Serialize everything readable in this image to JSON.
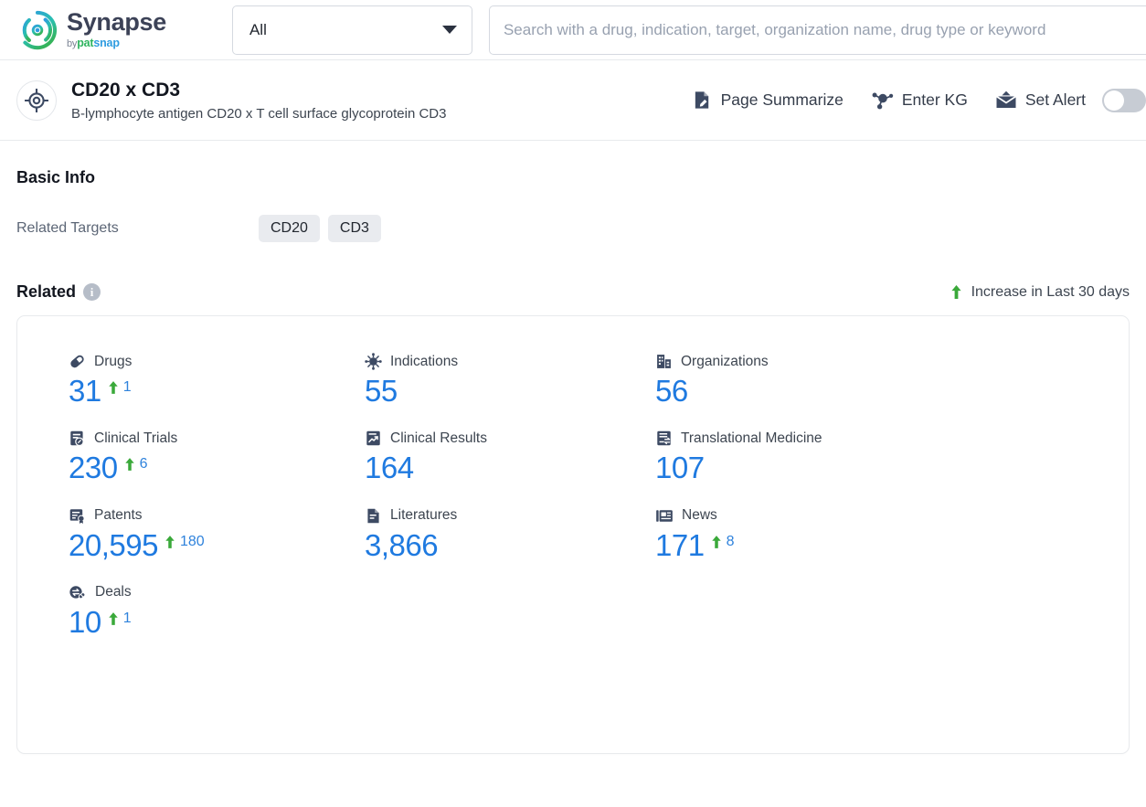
{
  "topbar": {
    "logo_name": "Synapse",
    "logo_by": "by",
    "logo_pat": "pat",
    "logo_snap": "snap",
    "scope_select_value": "All",
    "search_placeholder": "Search with a drug, indication, target, organization name, drug type or keyword",
    "search_value": ""
  },
  "entity": {
    "name": "CD20 x CD3",
    "description": "B-lymphocyte antigen CD20 x T cell surface glycoprotein CD3",
    "actions": [
      {
        "label": "Page Summarize",
        "icon": "page-summarize-icon"
      },
      {
        "label": "Enter KG",
        "icon": "knowledge-graph-icon"
      },
      {
        "label": "Set Alert",
        "icon": "alert-mail-icon"
      }
    ],
    "alert_toggle_on": false
  },
  "basic_info": {
    "title": "Basic Info",
    "related_targets_label": "Related Targets",
    "related_targets": [
      "CD20",
      "CD3"
    ]
  },
  "related": {
    "title": "Related",
    "info_glyph": "i",
    "legend_text": "Increase in Last 30 days",
    "legend_arrow_color": "#3aa93a",
    "value_color": "#1f7ae0",
    "stats": [
      {
        "label": "Drugs",
        "icon": "pill-icon",
        "value": "31",
        "delta": "1"
      },
      {
        "label": "Indications",
        "icon": "virus-icon",
        "value": "55",
        "delta": ""
      },
      {
        "label": "Organizations",
        "icon": "building-icon",
        "value": "56",
        "delta": ""
      },
      {
        "label": "Clinical Trials",
        "icon": "clinical-trial-icon",
        "value": "230",
        "delta": "6"
      },
      {
        "label": "Clinical Results",
        "icon": "clinical-result-icon",
        "value": "164",
        "delta": ""
      },
      {
        "label": "Translational Medicine",
        "icon": "translational-medicine-icon",
        "value": "107",
        "delta": ""
      },
      {
        "label": "Patents",
        "icon": "patent-icon",
        "value": "20,595",
        "delta": "180"
      },
      {
        "label": "Literatures",
        "icon": "literature-icon",
        "value": "3,866",
        "delta": ""
      },
      {
        "label": "News",
        "icon": "news-icon",
        "value": "171",
        "delta": "8"
      },
      {
        "label": "Deals",
        "icon": "deals-icon",
        "value": "10",
        "delta": "1"
      }
    ]
  }
}
